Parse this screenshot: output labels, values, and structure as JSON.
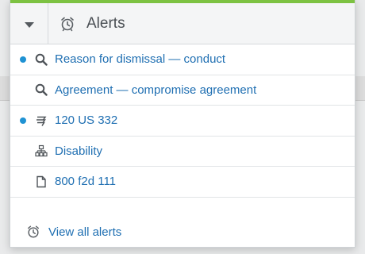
{
  "header": {
    "title": "Alerts",
    "toggle_icon": "chevron-down-icon",
    "title_icon": "alarm-clock-icon"
  },
  "items": [
    {
      "label": "Reason for dismissal — conduct",
      "icon": "search-icon",
      "unread": true
    },
    {
      "label": "Agreement — compromise agreement",
      "icon": "search-icon",
      "unread": false
    },
    {
      "label": "120 US 332",
      "icon": "citation-icon",
      "unread": true
    },
    {
      "label": "Disability",
      "icon": "hierarchy-icon",
      "unread": false
    },
    {
      "label": "800 f2d 111",
      "icon": "document-icon",
      "unread": false
    }
  ],
  "footer": {
    "label": "View all alerts",
    "icon": "alarm-clock-icon"
  },
  "colors": {
    "accent": "#7dc242",
    "link": "#1f6fb2",
    "unread_dot": "#1f92d3"
  }
}
